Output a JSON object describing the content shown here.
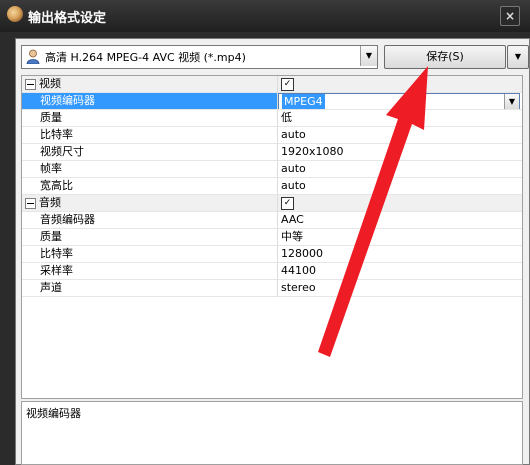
{
  "window": {
    "title": "输出格式设定",
    "close_glyph": "×",
    "icons": [
      "app-icon",
      "close-icon"
    ]
  },
  "toolbar": {
    "preset_label": "高清 H.264 MPEG-4 AVC 视频 (*.mp4)",
    "preset_icon": "user-icon",
    "save_label": "保存(S)",
    "dropdown_glyph": "▼"
  },
  "properties": {
    "video": {
      "label": "视频",
      "checked": true,
      "check_glyph": "✓",
      "items": [
        {
          "label": "视频编码器",
          "value": "MPEG4"
        },
        {
          "label": "质量",
          "value": "低"
        },
        {
          "label": "比特率",
          "value": "auto"
        },
        {
          "label": "视频尺寸",
          "value": "1920x1080"
        },
        {
          "label": "帧率",
          "value": "auto"
        },
        {
          "label": "宽高比",
          "value": "auto"
        }
      ]
    },
    "audio": {
      "label": "音频",
      "checked": true,
      "check_glyph": "✓",
      "items": [
        {
          "label": "音频编码器",
          "value": "AAC"
        },
        {
          "label": "质量",
          "value": "中等"
        },
        {
          "label": "比特率",
          "value": "128000"
        },
        {
          "label": "采样率",
          "value": "44100"
        },
        {
          "label": "声道",
          "value": "stereo"
        }
      ]
    }
  },
  "description": {
    "text": "视频编码器"
  },
  "colors": {
    "selection": "#3399ff",
    "annotation_arrow": "#ee1c24",
    "titlebar": "#2b2b2b"
  }
}
